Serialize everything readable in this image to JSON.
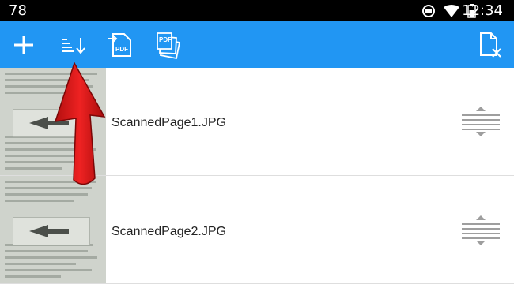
{
  "status_bar": {
    "temperature": "78",
    "time": "12:34",
    "icons": [
      "sync-circle-icon",
      "wifi-icon",
      "battery-icon"
    ]
  },
  "toolbar": {
    "color": "#2196f3",
    "buttons": [
      {
        "name": "add-button",
        "icon": "plus-icon"
      },
      {
        "name": "sort-button",
        "icon": "sort-icon"
      },
      {
        "name": "export-pdf-button",
        "icon": "pdf-export-icon",
        "icon_text": "PDF"
      },
      {
        "name": "pdf-pages-button",
        "icon": "pdf-pages-icon",
        "icon_text": "PDF"
      },
      {
        "name": "clear-files-button",
        "icon": "file-remove-icon"
      }
    ]
  },
  "files": [
    {
      "name": "ScannedPage1.JPG"
    },
    {
      "name": "ScannedPage2.JPG"
    }
  ],
  "annotation": {
    "color": "#e01b1b",
    "icon": "red-arrow-annotation"
  }
}
